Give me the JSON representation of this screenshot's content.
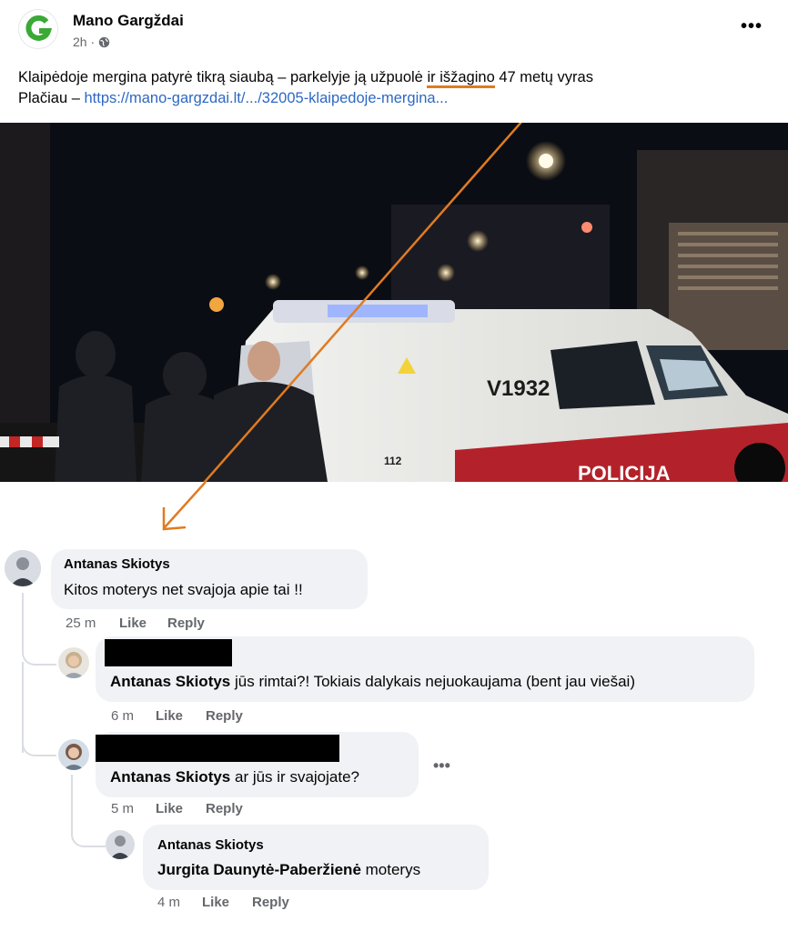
{
  "post": {
    "page_name": "Mano Gargždai",
    "time": "2h ·",
    "globe_icon": "globe-icon",
    "more": "•••",
    "text_part1": "Klaipėdoje mergina patyrė tikrą siaubą – parkelyje ją užpuolė ",
    "text_underlined1": "ir",
    "text_space": " ",
    "text_underlined2": "išžagino",
    "text_part2": " 47 metų vyras",
    "more_prefix": "Plačiau – ",
    "link": "https://mano-gargzdai.lt/.../32005-klaipedoje-mergina...",
    "photo_texts": {
      "van_number": "V1932",
      "phone": "112",
      "police": "POLICIJA"
    }
  },
  "comments": [
    {
      "author": "Antanas Skiotys",
      "text": "Kitos moterys net svajoja apie tai !!",
      "time": "25 m",
      "like": "Like",
      "reply": "Reply"
    },
    {
      "author_redacted": true,
      "mention": "Antanas Skiotys",
      "text": " jūs rimtai?! Tokiais dalykais nejuokaujama (bent jau viešai)",
      "time": "6 m",
      "like": "Like",
      "reply": "Reply"
    },
    {
      "author_redacted": true,
      "mention": "Antanas Skiotys",
      "text": " ar jūs ir svajojate?",
      "time": "5 m",
      "like": "Like",
      "reply": "Reply",
      "more": "•••"
    },
    {
      "author": "Antanas Skiotys",
      "mention": "Jurgita Daunytė-Paberžienė",
      "text": " moterys",
      "time": "4 m",
      "like": "Like",
      "reply": "Reply"
    }
  ],
  "colors": {
    "accent_orange": "#e07b20",
    "link_blue": "#2d68c4",
    "brand_green": "#3aa935"
  }
}
